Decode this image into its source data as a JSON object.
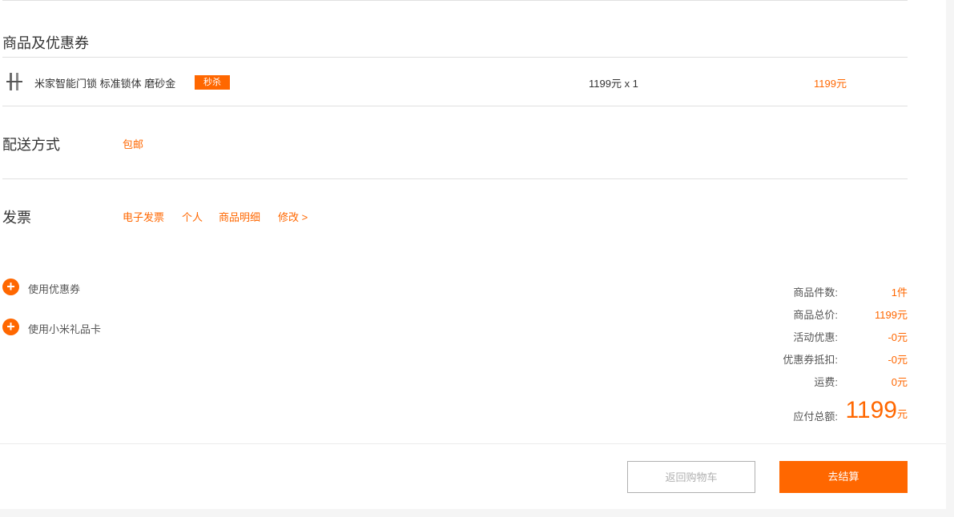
{
  "colors": {
    "accent": "#ff6700",
    "divider": "#e0e0e0",
    "text": "#333333",
    "muted": "#b0b0b0"
  },
  "goods": {
    "title": "商品及优惠券",
    "item": {
      "icon": "door-lock-thumbnail",
      "name": "米家智能门锁 标准锁体 磨砂金",
      "badge": "秒杀",
      "price_qty": "1199元 x 1",
      "subtotal": "1199元"
    }
  },
  "shipping": {
    "title": "配送方式",
    "value": "包邮"
  },
  "invoice": {
    "title": "发票",
    "type": "电子发票",
    "person": "个人",
    "content": "商品明细",
    "edit": "修改 >"
  },
  "extras": {
    "coupon": {
      "icon": "plus-circle-icon",
      "label": "使用优惠券"
    },
    "giftcard": {
      "icon": "plus-circle-icon",
      "label": "使用小米礼品卡"
    }
  },
  "summary": {
    "count_label": "商品件数:",
    "count_value": "1件",
    "total_label": "商品总价:",
    "total_value": "1199元",
    "promo_label": "活动优惠:",
    "promo_value": "-0元",
    "coupon_label": "优惠券抵扣:",
    "coupon_value": "-0元",
    "freight_label": "运费:",
    "freight_value": "0元",
    "payable_label": "应付总额:",
    "payable_amount": "1199",
    "payable_unit": "元"
  },
  "actions": {
    "back_label": "返回购物车",
    "checkout_label": "去结算"
  }
}
